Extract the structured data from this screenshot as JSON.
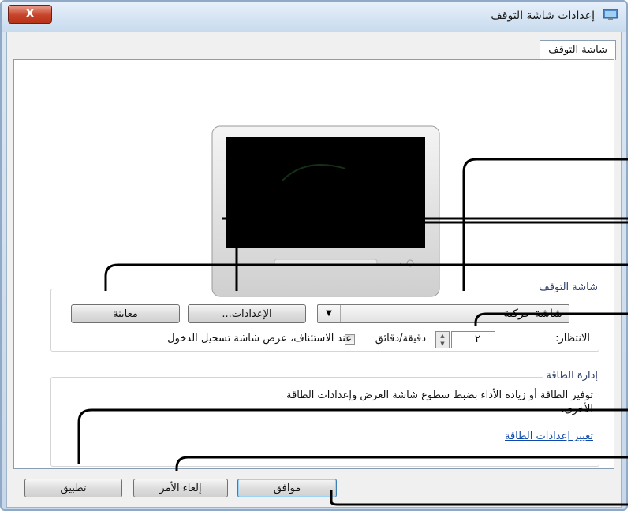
{
  "window": {
    "title": "إعدادات شاشة التوقف",
    "close_label": "X"
  },
  "tab": {
    "label": "شاشة التوقف"
  },
  "screensaver": {
    "group_label": "شاشة التوقف",
    "selected": "شاشة حركية",
    "settings_button": "الإعدادات...",
    "preview_button": "معاينة",
    "wait_label": "الانتظار:",
    "wait_value": "٢",
    "minutes_label": "دقيقة/دقائق",
    "resume_label": "عند الاستئناف، عرض شاشة تسجيل الدخول",
    "resume_checked": false
  },
  "power": {
    "group_label": "إدارة الطاقة",
    "description_line1": "توفير الطاقة أو زيادة الأداء بضبط سطوع شاشة العرض وإعدادات الطاقة",
    "description_line2": "الأخرى.",
    "link": "تغيير إعدادات الطاقة"
  },
  "buttons": {
    "ok": "موافق",
    "cancel": "إلغاء الأمر",
    "apply": "تطبيق"
  }
}
